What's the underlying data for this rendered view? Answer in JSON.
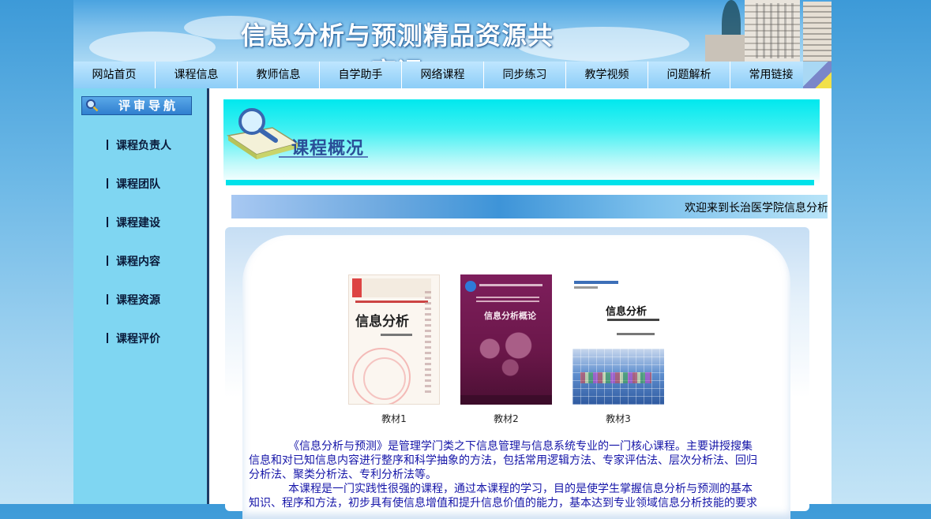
{
  "site": {
    "title": "信息分析与预测精品资源共享课"
  },
  "nav": {
    "items": [
      "网站首页",
      "课程信息",
      "教师信息",
      "自学助手",
      "网络课程",
      "同步练习",
      "教学视频",
      "问题解析",
      "常用链接"
    ]
  },
  "sidebar": {
    "heading": "评审导航",
    "items": [
      "课程负责人",
      "课程团队",
      "课程建设",
      "课程内容",
      "课程资源",
      "课程评价"
    ]
  },
  "overview": {
    "title": "课程概况"
  },
  "marquee": {
    "text": "欢迎来到长治医学院信息分析"
  },
  "books": [
    {
      "label": "教材1",
      "cover_title": "信息分析"
    },
    {
      "label": "教材2",
      "cover_title": "信息分析概论"
    },
    {
      "label": "教材3",
      "cover_title": "信息分析"
    }
  ],
  "description": {
    "para1": "《信息分析与预测》是管理学门类之下信息管理与信息系统专业的一门核心课程。主要讲授搜集信息和对已知信息内容进行整序和科学抽象的方法，包括常用逻辑方法、专家评估法、层次分析法、回归分析法、聚类分析法、专利分析法等。",
    "para2": "本课程是一门实践性很强的课程，通过本课程的学习，目的是使学生掌握信息分析与预测的基本知识、程序和方法，初步具有使信息增值和提升信息价值的能力，基本达到专业领域信息分析技能的要求"
  },
  "colors": {
    "nav_bg": "#8ccdf7",
    "sidebar_bg": "#7fd6f2",
    "overview_cyan": "#00e8ee",
    "desc_text": "#1515a8"
  }
}
